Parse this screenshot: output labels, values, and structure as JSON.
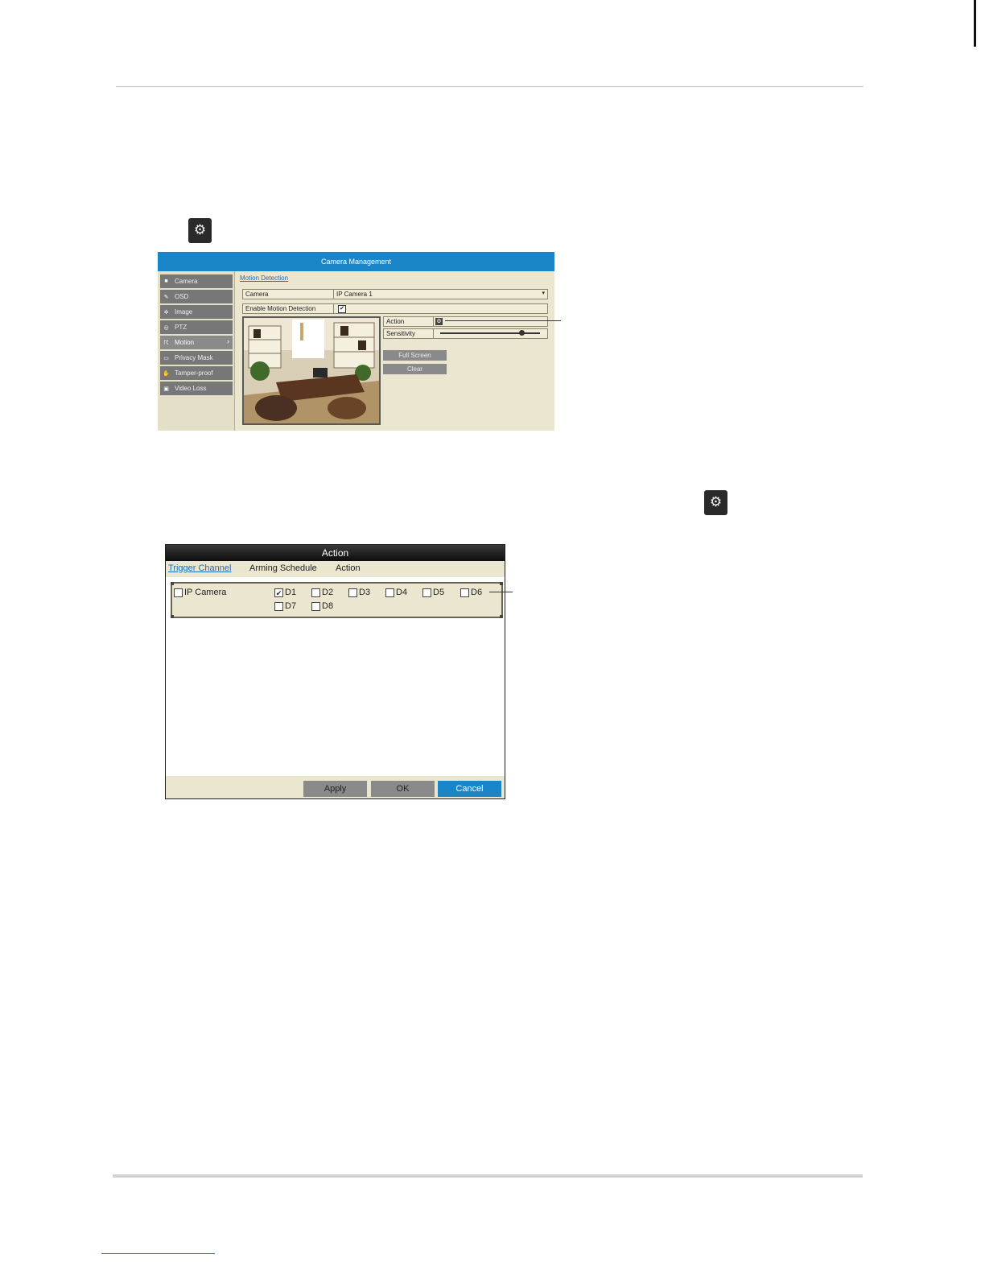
{
  "camera_management": {
    "title": "Camera Management",
    "sidebar": [
      {
        "label": "Camera",
        "icon": "camera-icon"
      },
      {
        "label": "OSD",
        "icon": "osd-icon"
      },
      {
        "label": "Image",
        "icon": "image-icon"
      },
      {
        "label": "PTZ",
        "icon": "ptz-icon"
      },
      {
        "label": "Motion",
        "icon": "motion-icon",
        "active": true
      },
      {
        "label": "Privacy Mask",
        "icon": "privacy-mask-icon"
      },
      {
        "label": "Tamper-proof",
        "icon": "tamper-proof-icon"
      },
      {
        "label": "Video Loss",
        "icon": "video-loss-icon"
      }
    ],
    "tab": "Motion Detection",
    "camera_label": "Camera",
    "camera_value": "IP Camera 1",
    "enable_label": "Enable Motion Detection",
    "enable_checked": "✔",
    "action_label": "Action",
    "sensitivity_label": "Sensitivity",
    "sensitivity_level": 0.82,
    "full_screen_label": "Full Screen",
    "clear_label": "Clear"
  },
  "action_dialog": {
    "title": "Action",
    "tabs": [
      "Trigger Channel",
      "Arming Schedule",
      "Action"
    ],
    "ip_camera_label": "IP Camera",
    "channels": [
      {
        "label": "D1",
        "checked": true
      },
      {
        "label": "D2",
        "checked": false
      },
      {
        "label": "D3",
        "checked": false
      },
      {
        "label": "D4",
        "checked": false
      },
      {
        "label": "D5",
        "checked": false
      },
      {
        "label": "D6",
        "checked": false
      },
      {
        "label": "D7",
        "checked": false
      },
      {
        "label": "D8",
        "checked": false
      }
    ],
    "check_mark": "✔",
    "buttons": {
      "apply": "Apply",
      "ok": "OK",
      "cancel": "Cancel"
    }
  },
  "colors": {
    "title_blue": "#1a86c8",
    "panel_beige": "#ebe6cf",
    "button_gray": "#8a8a8a"
  }
}
